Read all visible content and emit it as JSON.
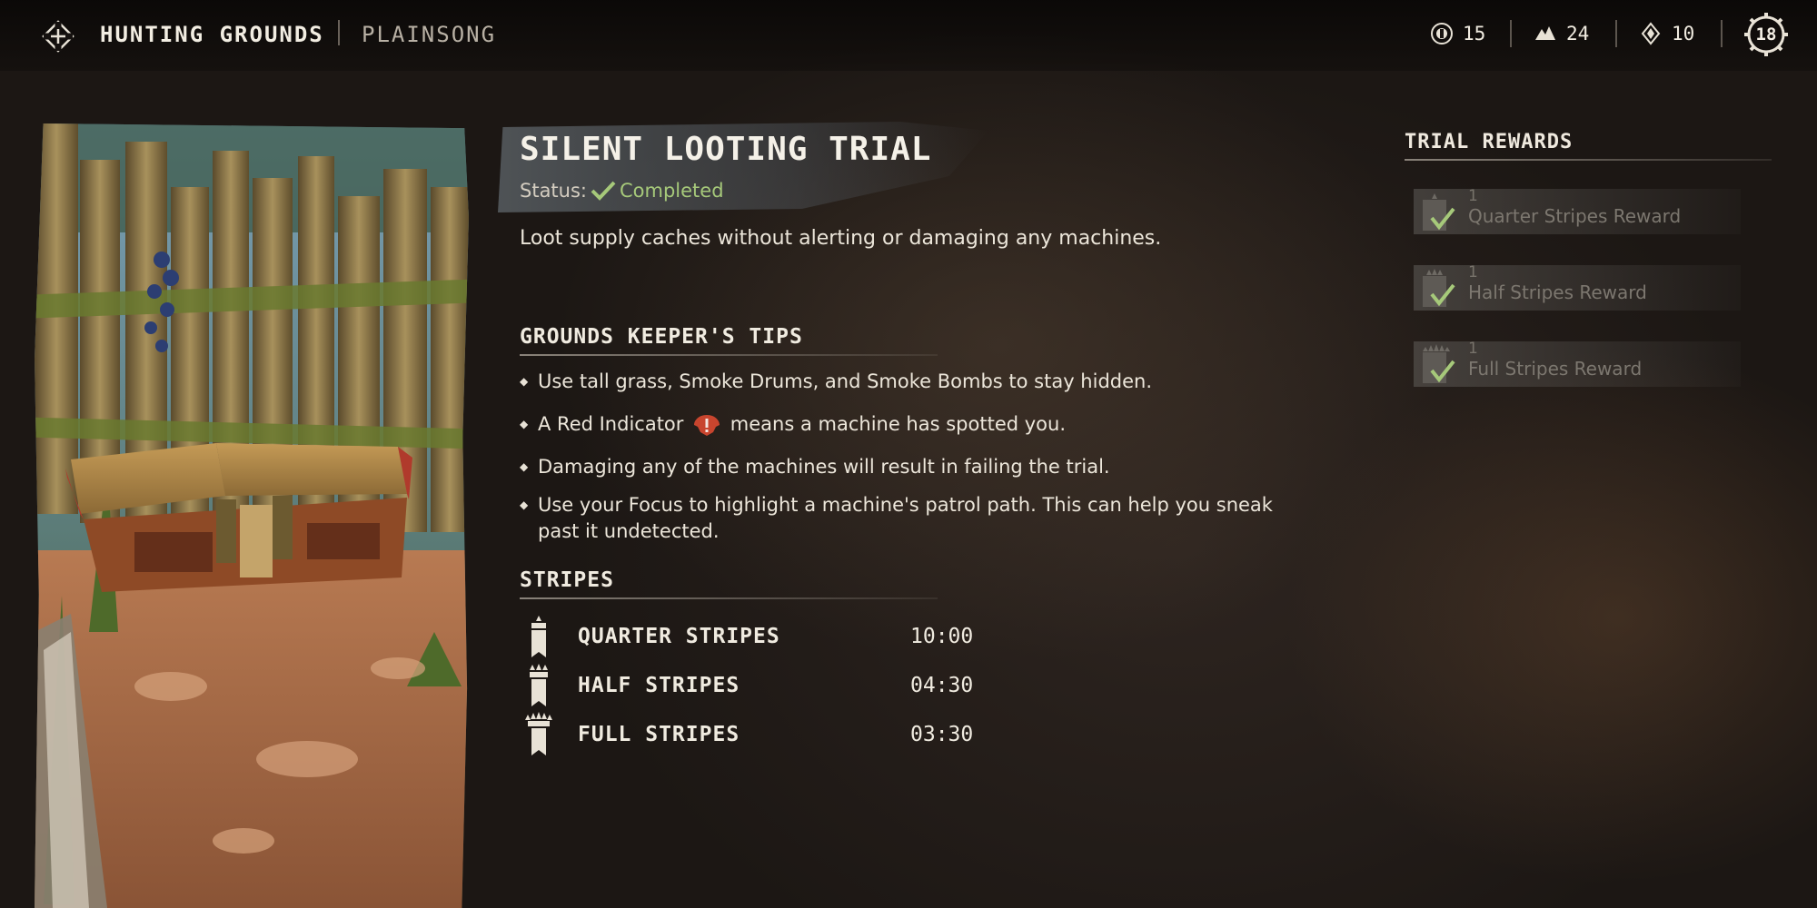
{
  "header": {
    "breadcrumb_primary": "HUNTING GROUNDS",
    "breadcrumb_secondary": "PLAINSONG",
    "stats": [
      {
        "icon": "medal-icon",
        "value": "15"
      },
      {
        "icon": "shard-pile-icon",
        "value": "24"
      },
      {
        "icon": "skill-point-icon",
        "value": "10"
      }
    ],
    "level": "18"
  },
  "trial": {
    "title": "SILENT LOOTING TRIAL",
    "status_label": "Status:",
    "status_value": "Completed",
    "description": "Loot supply caches without alerting or damaging any machines."
  },
  "tips": {
    "heading": "GROUNDS KEEPER'S TIPS",
    "items": [
      "Use tall grass, Smoke Drums, and Smoke Bombs to stay hidden.",
      "A Red Indicator",
      "means a machine has spotted you.",
      "Damaging any of the machines will result in failing the trial.",
      "Use your Focus to highlight a machine's patrol path. This can help you sneak past it undetected."
    ]
  },
  "stripes": {
    "heading": "STRIPES",
    "rows": [
      {
        "name": "QUARTER STRIPES",
        "time": "10:00"
      },
      {
        "name": "HALF STRIPES",
        "time": "04:30"
      },
      {
        "name": "FULL STRIPES",
        "time": "03:30"
      }
    ]
  },
  "rewards": {
    "heading": "TRIAL REWARDS",
    "items": [
      {
        "qty": "1",
        "name": "Quarter Stripes Reward"
      },
      {
        "qty": "1",
        "name": "Half Stripes Reward"
      },
      {
        "qty": "1",
        "name": "Full Stripes Reward"
      }
    ]
  },
  "colors": {
    "completed_green": "#a6c97a",
    "red_indicator": "#c8452e",
    "reward_dim": "#7c776f"
  }
}
